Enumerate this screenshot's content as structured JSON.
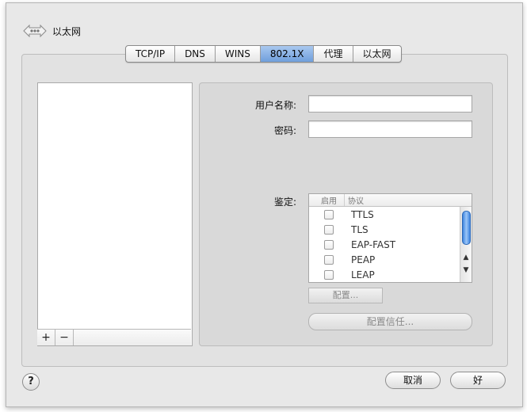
{
  "header": {
    "title": "以太网",
    "icon": "ethernet-icon"
  },
  "tabs": [
    {
      "label": "TCP/IP",
      "active": false
    },
    {
      "label": "DNS",
      "active": false
    },
    {
      "label": "WINS",
      "active": false
    },
    {
      "label": "802.1X",
      "active": true
    },
    {
      "label": "代理",
      "active": false
    },
    {
      "label": "以太网",
      "active": false
    }
  ],
  "list_tools": {
    "add": "+",
    "remove": "−"
  },
  "form": {
    "username_label": "用户名称:",
    "password_label": "密码:",
    "auth_label": "鉴定:"
  },
  "auth_table": {
    "col_enable": "启用",
    "col_protocol": "协议",
    "rows": [
      {
        "protocol": "TTLS",
        "enabled": false
      },
      {
        "protocol": "TLS",
        "enabled": false
      },
      {
        "protocol": "EAP-FAST",
        "enabled": false
      },
      {
        "protocol": "PEAP",
        "enabled": false
      },
      {
        "protocol": "LEAP",
        "enabled": false
      }
    ]
  },
  "buttons": {
    "configure": "配置...",
    "configure_trust": "配置信任...",
    "cancel": "取消",
    "ok": "好",
    "help": "?"
  }
}
